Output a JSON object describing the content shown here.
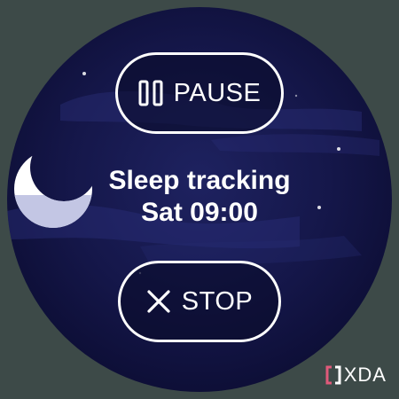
{
  "app": {
    "title": "Sleep tracking",
    "time": "Sat 09:00"
  },
  "actions": {
    "pause_label": "PAUSE",
    "pause_icon": "pause-icon",
    "stop_label": "STOP",
    "stop_icon": "close-icon"
  },
  "watermark": {
    "brand": "XDA",
    "logo_icon": "xda-bracket-icon"
  },
  "colors": {
    "background": "#3d4a48",
    "sky": "#15174a",
    "button_border": "#ffffff",
    "text": "#ffffff",
    "logo_accent": "#e05a7a"
  }
}
